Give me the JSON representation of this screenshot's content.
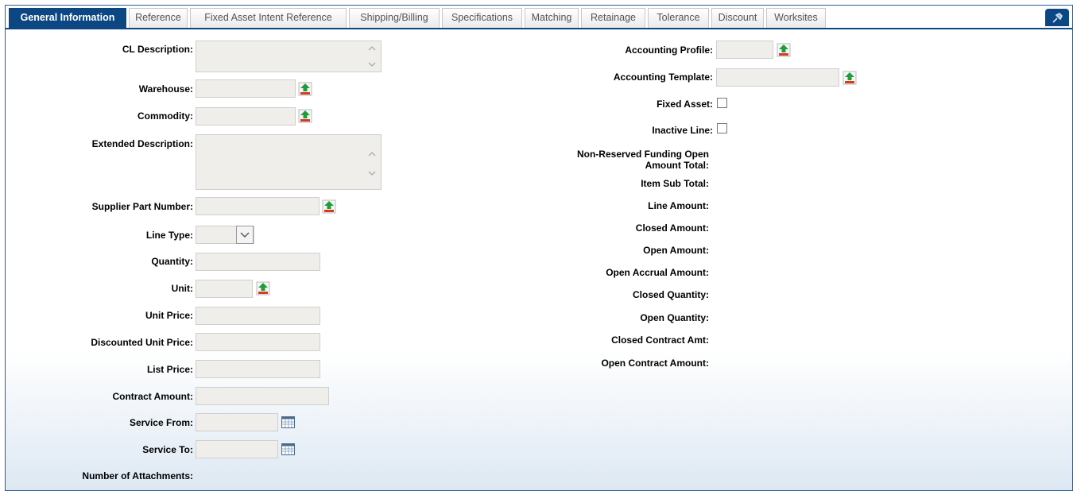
{
  "tabs": [
    {
      "label": "General Information",
      "active": true
    },
    {
      "label": "Reference"
    },
    {
      "label": "Fixed Asset Intent Reference"
    },
    {
      "label": "Shipping/Billing"
    },
    {
      "label": "Specifications"
    },
    {
      "label": "Matching"
    },
    {
      "label": "Retainage"
    },
    {
      "label": "Tolerance"
    },
    {
      "label": "Discount"
    },
    {
      "label": "Worksites"
    }
  ],
  "left": {
    "cl_description": "CL Description:",
    "warehouse": "Warehouse:",
    "commodity": "Commodity:",
    "extended_description": "Extended Description:",
    "supplier_part_number": "Supplier Part Number:",
    "line_type": "Line Type:",
    "quantity": "Quantity:",
    "unit": "Unit:",
    "unit_price": "Unit Price:",
    "discounted_unit_price": "Discounted Unit Price:",
    "list_price": "List Price:",
    "contract_amount": "Contract Amount:",
    "service_from": "Service From:",
    "service_to": "Service To:",
    "number_of_attachments": "Number of Attachments:"
  },
  "right": {
    "accounting_profile": "Accounting Profile:",
    "accounting_template": "Accounting Template:",
    "fixed_asset": "Fixed Asset:",
    "inactive_line": "Inactive Line:",
    "nonreserved_line1": "Non-Reserved Funding Open",
    "nonreserved_line2": "Amount Total:",
    "item_sub_total": "Item Sub Total:",
    "line_amount": "Line Amount:",
    "closed_amount": "Closed Amount:",
    "open_amount": "Open Amount:",
    "open_accrual_amount": "Open Accrual Amount:",
    "closed_quantity": "Closed Quantity:",
    "open_quantity": "Open Quantity:",
    "closed_contract_amt": "Closed Contract Amt:",
    "open_contract_amount": "Open Contract Amount:"
  },
  "colors": {
    "accent": "#0c4783",
    "field_bg": "#efeeea",
    "lookup_green": "#1f9d3a",
    "lookup_red": "#d9391f"
  }
}
